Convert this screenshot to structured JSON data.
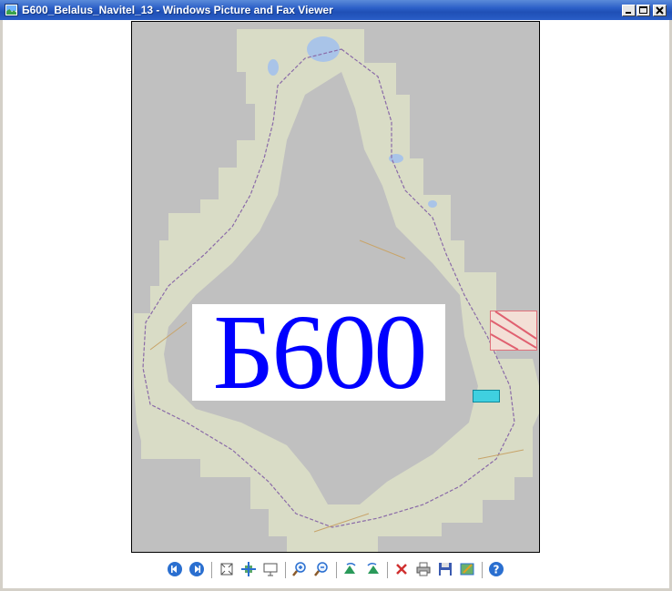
{
  "window": {
    "title": "Б600_Belalus_Navitel_13 - Windows Picture and Fax Viewer"
  },
  "image": {
    "label": "Б600"
  },
  "toolbar": {
    "buttons": [
      {
        "name": "previous-image",
        "icon": "prev-icon"
      },
      {
        "name": "next-image",
        "icon": "next-icon"
      },
      {
        "name": "best-fit",
        "icon": "best-fit-icon"
      },
      {
        "name": "actual-size",
        "icon": "actual-size-icon"
      },
      {
        "name": "slide-show",
        "icon": "slideshow-icon"
      },
      {
        "name": "zoom-in",
        "icon": "zoom-in-icon"
      },
      {
        "name": "zoom-out",
        "icon": "zoom-out-icon"
      },
      {
        "name": "rotate-clockwise",
        "icon": "rotate-cw-icon"
      },
      {
        "name": "rotate-counterclockwise",
        "icon": "rotate-ccw-icon"
      },
      {
        "name": "delete",
        "icon": "delete-icon"
      },
      {
        "name": "print",
        "icon": "print-icon"
      },
      {
        "name": "save-copy",
        "icon": "save-icon"
      },
      {
        "name": "close-and-edit",
        "icon": "edit-icon"
      },
      {
        "name": "help",
        "icon": "help-icon"
      }
    ]
  },
  "colors": {
    "titlebar": "#2c60c8",
    "map_background": "#c0c0c0",
    "label_text": "#0000ff"
  }
}
